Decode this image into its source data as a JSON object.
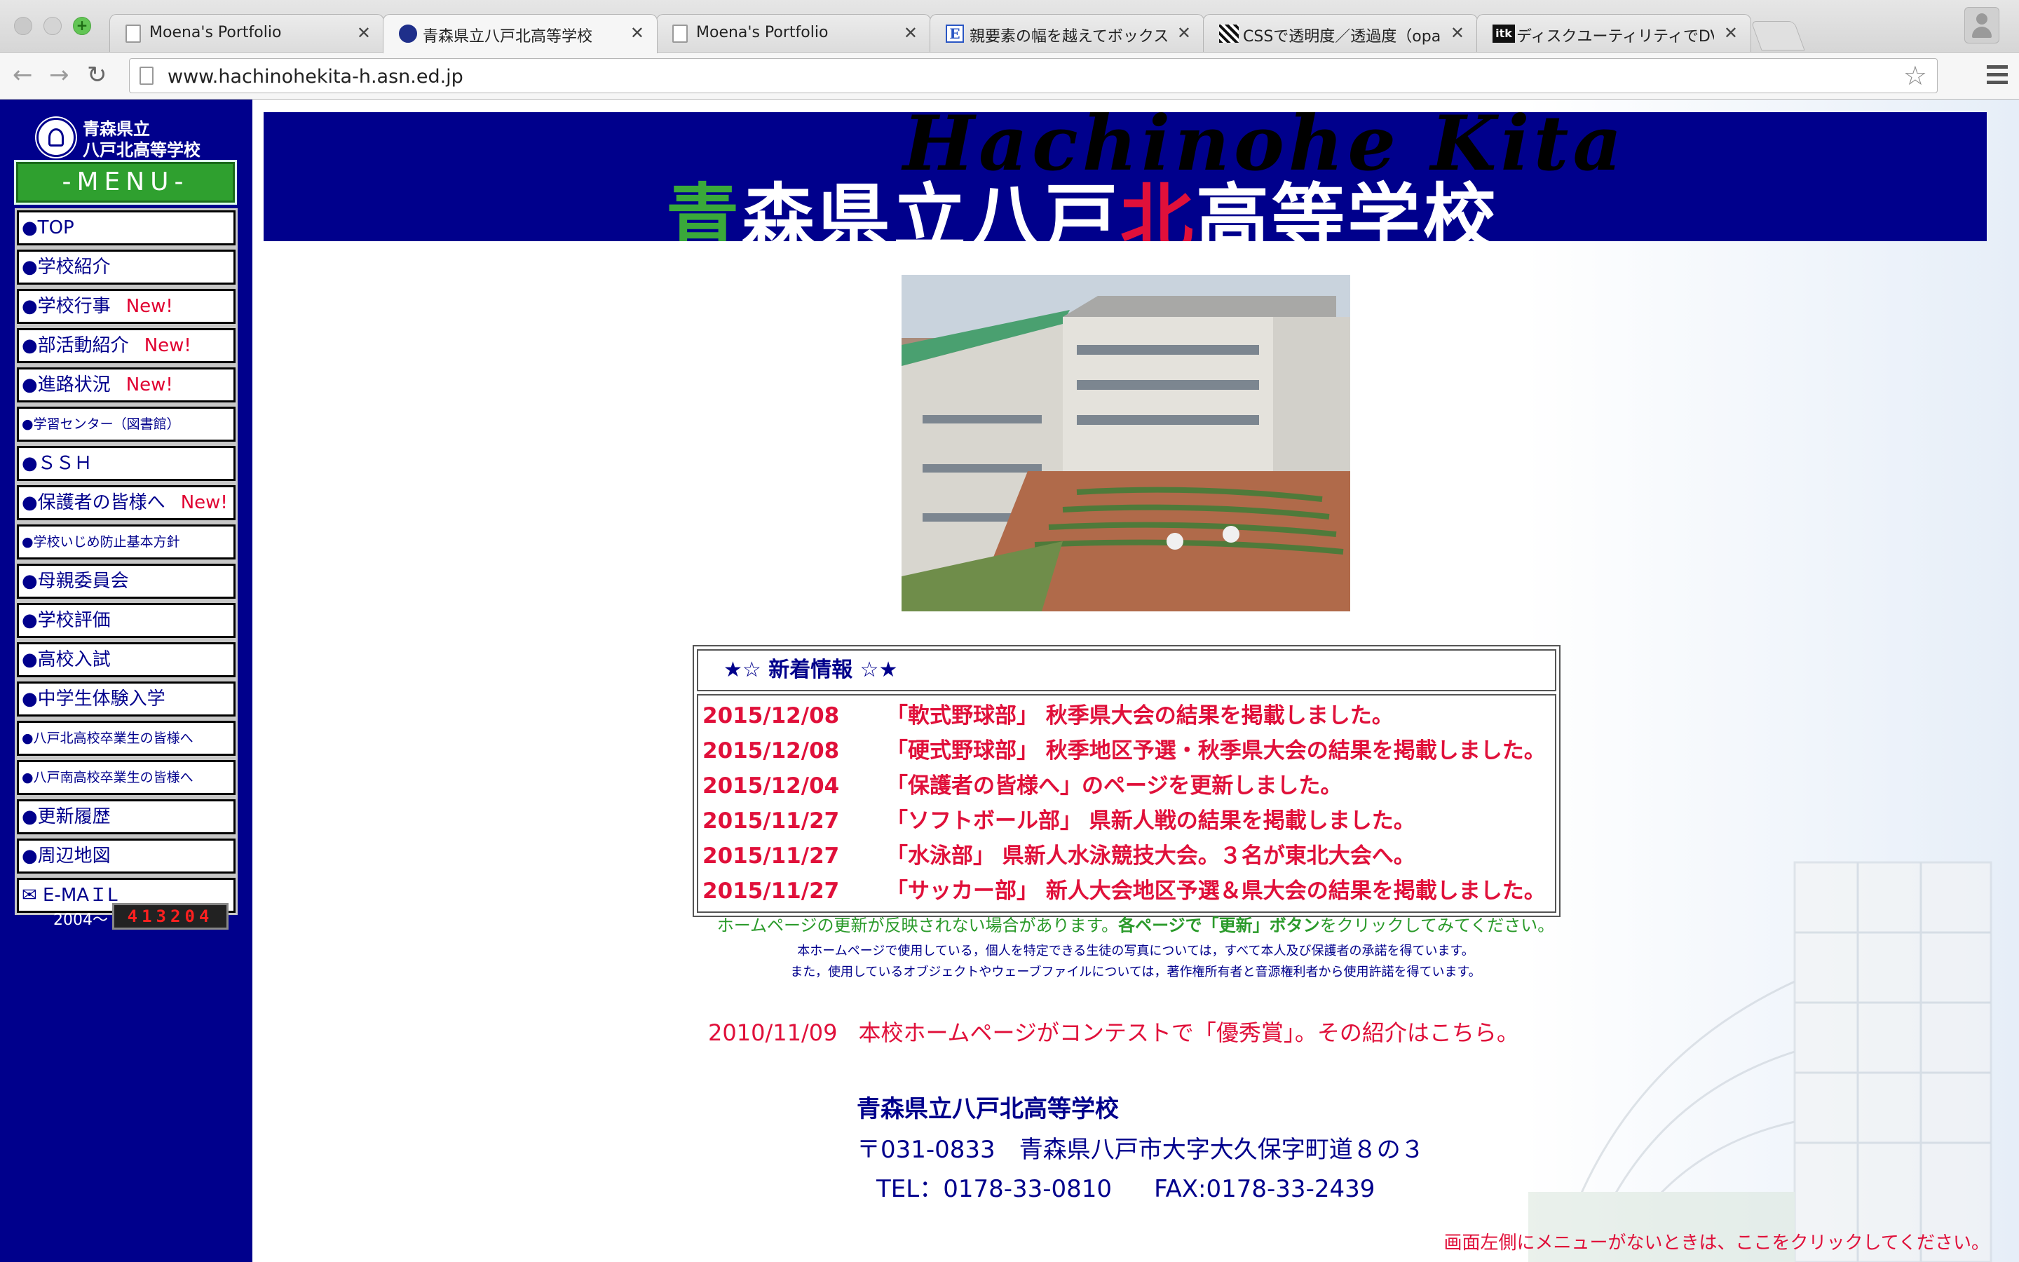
{
  "browser": {
    "tabs": [
      {
        "title": "Moena's Portfolio",
        "icon": "document-icon",
        "active": false
      },
      {
        "title": "青森県立八戸北高等学校",
        "icon": "school-seal-icon",
        "active": true
      },
      {
        "title": "Moena's Portfolio",
        "icon": "document-icon",
        "active": false
      },
      {
        "title": "親要素の幅を越えてボックスの",
        "icon": "e-icon",
        "active": false
      },
      {
        "title": "CSSで透明度／透過度（opaci",
        "icon": "flag-icon",
        "active": false
      },
      {
        "title": "ディスクユーティリティでDVD",
        "icon": "itk-icon",
        "active": false
      }
    ],
    "itk_label": "itk",
    "e_label": "E",
    "url": "www.hachinohekita-h.asn.ed.jp"
  },
  "sidebar": {
    "logo_line1": "青森県立",
    "logo_line2": "八戸北高等学校",
    "menu_title": "-MENU-",
    "items": [
      {
        "label": "●TOP",
        "new": ""
      },
      {
        "label": "●学校紹介",
        "new": ""
      },
      {
        "label": "●学校行事",
        "new": "New!"
      },
      {
        "label": "●部活動紹介",
        "new": "New!"
      },
      {
        "label": "●進路状況",
        "new": "New!"
      },
      {
        "label": "●学習センター（図書館）",
        "new": ""
      },
      {
        "label": "●ＳＳＨ",
        "new": ""
      },
      {
        "label": "●保護者の皆様へ",
        "new": "New!"
      },
      {
        "label": "●学校いじめ防止基本方針",
        "new": ""
      },
      {
        "label": "●母親委員会",
        "new": ""
      },
      {
        "label": "●学校評価",
        "new": ""
      },
      {
        "label": "●高校入試",
        "new": ""
      },
      {
        "label": "●中学生体験入学",
        "new": ""
      },
      {
        "label": "●八戸北高校卒業生の皆様へ",
        "new": ""
      },
      {
        "label": "●八戸南高校卒業生の皆様へ",
        "new": ""
      },
      {
        "label": "●更新履歴",
        "new": ""
      },
      {
        "label": "●周辺地図",
        "new": ""
      },
      {
        "label": "✉ E-MAＩL",
        "new": ""
      }
    ],
    "counter_label": "2004〜",
    "counter_value": "413204"
  },
  "banner": {
    "script_text": "Hachinohe Kita",
    "title_part1": "青",
    "title_part2": "森県立八戸",
    "title_part3": "北",
    "title_part4": "高等学校"
  },
  "news": {
    "header": "★☆ 新着情報 ☆★",
    "items": [
      {
        "date": "2015/12/08",
        "text": "「軟式野球部」 秋季県大会の結果を掲載しました。"
      },
      {
        "date": "2015/12/08",
        "text": "「硬式野球部」 秋季地区予選・秋季県大会の結果を掲載しました。"
      },
      {
        "date": "2015/12/04",
        "text": "「保護者の皆様へ」のページを更新しました。"
      },
      {
        "date": "2015/11/27",
        "text": "「ソフトボール部」 県新人戦の結果を掲載しました。"
      },
      {
        "date": "2015/11/27",
        "text": "「水泳部」 県新人水泳競技大会。３名が東北大会へ。"
      },
      {
        "date": "2015/11/27",
        "text": "「サッカー部」 新人大会地区予選＆県大会の結果を掲載しました。"
      }
    ]
  },
  "notices": {
    "reload_pre": "ホームページの更新が反映されない場合があります。",
    "reload_bold": "各ページで「更新」ボタン",
    "reload_post": "をクリックしてみてください。",
    "privacy": "本ホームページで使用している，個人を特定できる生徒の写真については，すべて本人及び保護者の承諾を得ています。",
    "copyright": "また，使用しているオブジェクトやウェーブファイルについては，著作権所有者と音源権利者から使用許諾を得ています。"
  },
  "award": {
    "date": "2010/11/09",
    "text": "本校ホームページがコンテストで「優秀賞」。その紹介はこちら。"
  },
  "address": {
    "name": "青森県立八戸北高等学校",
    "postal": "〒031-0833　青森県八戸市大字大久保字町道８の３",
    "tel": "TEL：0178-33-0810",
    "fax": "FAX:0178-33-2439"
  },
  "footer_link": "画面左側にメニューがないときは、ここをクリックしてください。",
  "colors": {
    "navy": "#00008c",
    "red": "#e0103a",
    "green": "#2fa02f"
  }
}
